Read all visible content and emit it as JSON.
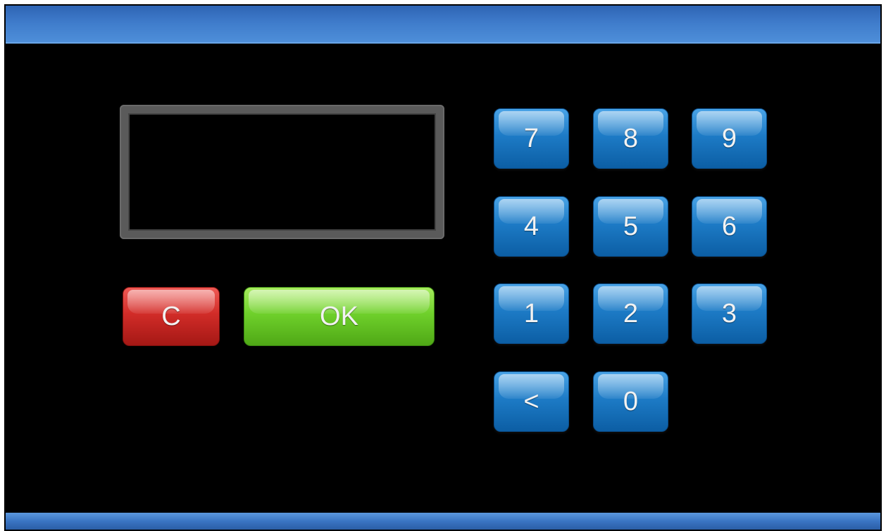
{
  "display": {
    "value": ""
  },
  "keypad": {
    "keys": [
      "7",
      "8",
      "9",
      "4",
      "5",
      "6",
      "1",
      "2",
      "3",
      "<",
      "0"
    ]
  },
  "actions": {
    "clear_label": "C",
    "ok_label": "OK"
  },
  "colors": {
    "top_bar": "#3f7ccb",
    "key_blue": "#1d7bc6",
    "clear_red": "#d22c28",
    "ok_green": "#6fd02b",
    "background": "#000000",
    "display_frame": "#5a5a5a"
  }
}
